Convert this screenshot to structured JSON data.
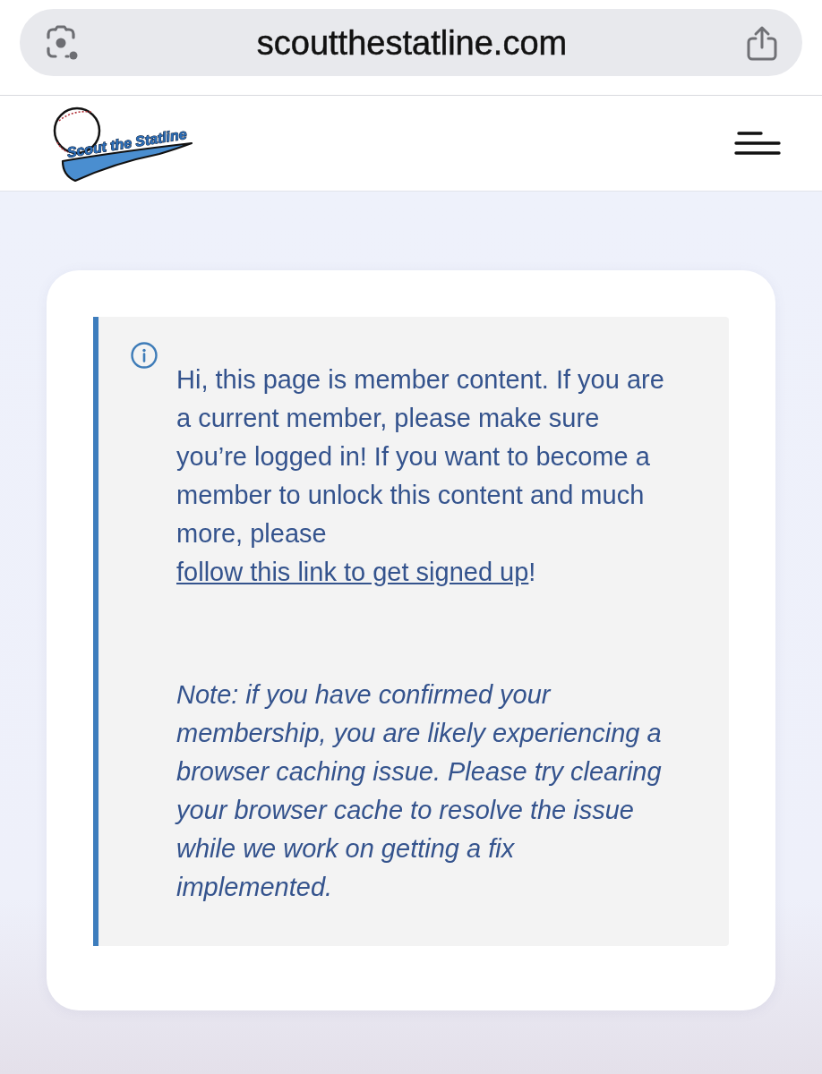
{
  "browser": {
    "url": "scoutthestatline.com"
  },
  "header": {
    "logo_text": "Scout the Statline"
  },
  "notice": {
    "paragraphs": [
      {
        "kind": "message",
        "text": "Hi, this page is member content. If you are a current member, please make sure you’re logged in! If you want to become a member to unlock this content and much more, please",
        "link": "follow this link to get signed up",
        "after_link": "!"
      },
      {
        "kind": "note",
        "text": "Note: if you have confirmed your membership, you are likely experiencing a browser caching issue. Please try clearing your browser cache to resolve the issue while we work on getting a fix implemented."
      }
    ]
  }
}
